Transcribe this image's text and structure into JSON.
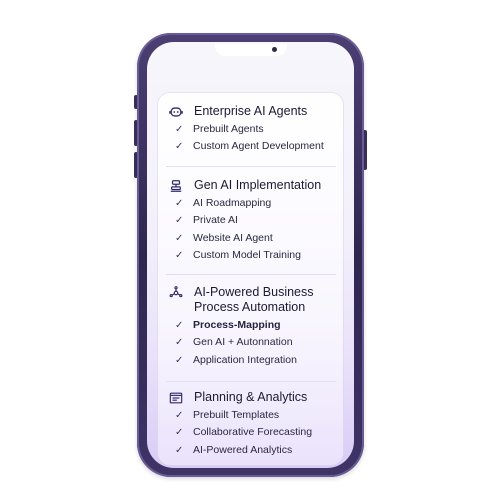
{
  "sections": [
    {
      "title": "Enterprise AI Agents",
      "icon": "robot-head-icon",
      "items": [
        {
          "label": "Prebuilt Agents"
        },
        {
          "label": "Custom Agent Development"
        }
      ]
    },
    {
      "title": "Gen AI Implementation",
      "icon": "robot-arm-icon",
      "items": [
        {
          "label": "AI Roadmapping"
        },
        {
          "label": "Private AI"
        },
        {
          "label": "Website AI Agent"
        },
        {
          "label": "Custom Model Training"
        }
      ]
    },
    {
      "title": "AI-Powered Business Process Automation",
      "icon": "network-nodes-icon",
      "items": [
        {
          "label": "Process-Mapping"
        },
        {
          "label": "Gen AI + Autonnation"
        },
        {
          "label": "Application Integration"
        }
      ]
    },
    {
      "title": "Planning & Analytics",
      "icon": "dashboard-window-icon",
      "items": [
        {
          "label": "Prebuilt Templates"
        },
        {
          "label": "Collaborative Forecasting"
        },
        {
          "label": "AI-Powered Analytics"
        }
      ]
    }
  ],
  "colors": {
    "phone_frame": "#2f2650",
    "screen_top": "#f7f6fb",
    "screen_bottom": "#d9ccf6",
    "icon": "#2f2a6b",
    "text": "#1c1a33"
  }
}
